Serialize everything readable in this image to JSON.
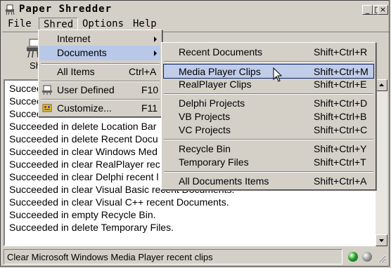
{
  "window": {
    "title": "Paper Shredder",
    "buttons": {
      "minimize": "_",
      "maximize": "□",
      "close": "×"
    }
  },
  "menubar": {
    "items": [
      {
        "label": "File",
        "active": false
      },
      {
        "label": "Shred",
        "active": true
      },
      {
        "label": "Options",
        "active": false
      },
      {
        "label": "Help",
        "active": false
      }
    ]
  },
  "toolbar": {
    "shred_label": "Sh"
  },
  "log": {
    "lines": [
      "Succeeded",
      "Succeeded",
      "Succeeded",
      "Succeeded in delete Location Bar",
      "Succeeded in delete Recent Docu",
      "Succeeded in clear Windows Med",
      "Succeeded in clear RealPlayer rec",
      "Succeeded in clear Delphi recent l",
      "Succeeded in clear Visual Basic recent Documents.",
      "Succeeded in clear Visual C++ recent Documents.",
      "Succeeded in empty Recycle Bin.",
      "Succeeded in delete Temporary Files."
    ]
  },
  "status": {
    "text": "Clear Microsoft Windows Media Player recent clips",
    "led_colors": [
      "#1fa21f",
      "#a0a0a0"
    ]
  },
  "shred_menu": {
    "items": [
      {
        "label": "Internet",
        "shortcut": "",
        "submenu": true,
        "icon": ""
      },
      {
        "label": "Documents",
        "shortcut": "",
        "submenu": true,
        "icon": ""
      },
      {
        "label": "All Items",
        "shortcut": "Ctrl+A",
        "submenu": false,
        "icon": ""
      },
      {
        "label": "User Defined",
        "shortcut": "F10",
        "submenu": false,
        "icon": "user-defined-icon"
      },
      {
        "label": "Customize...",
        "shortcut": "F11",
        "submenu": false,
        "icon": "customize-icon"
      }
    ]
  },
  "documents_menu": {
    "items": [
      {
        "label": "Recent Documents",
        "shortcut": "Shift+Ctrl+R"
      },
      {
        "label": "Media Player Clips",
        "shortcut": "Shift+Ctrl+M"
      },
      {
        "label": "RealPlayer Clips",
        "shortcut": "Shift+Ctrl+E"
      },
      {
        "label": "Delphi Projects",
        "shortcut": "Shift+Ctrl+D"
      },
      {
        "label": "VB Projects",
        "shortcut": "Shift+Ctrl+B"
      },
      {
        "label": "VC Projects",
        "shortcut": "Shift+Ctrl+C"
      },
      {
        "label": "Recycle Bin",
        "shortcut": "Shift+Ctrl+Y"
      },
      {
        "label": "Temporary Files",
        "shortcut": "Shift+Ctrl+T"
      },
      {
        "label": "All Documents Items",
        "shortcut": "Shift+Ctrl+A"
      }
    ]
  },
  "colors": {
    "highlight": "#b8c8e8",
    "selected_border": "#0a246a"
  }
}
